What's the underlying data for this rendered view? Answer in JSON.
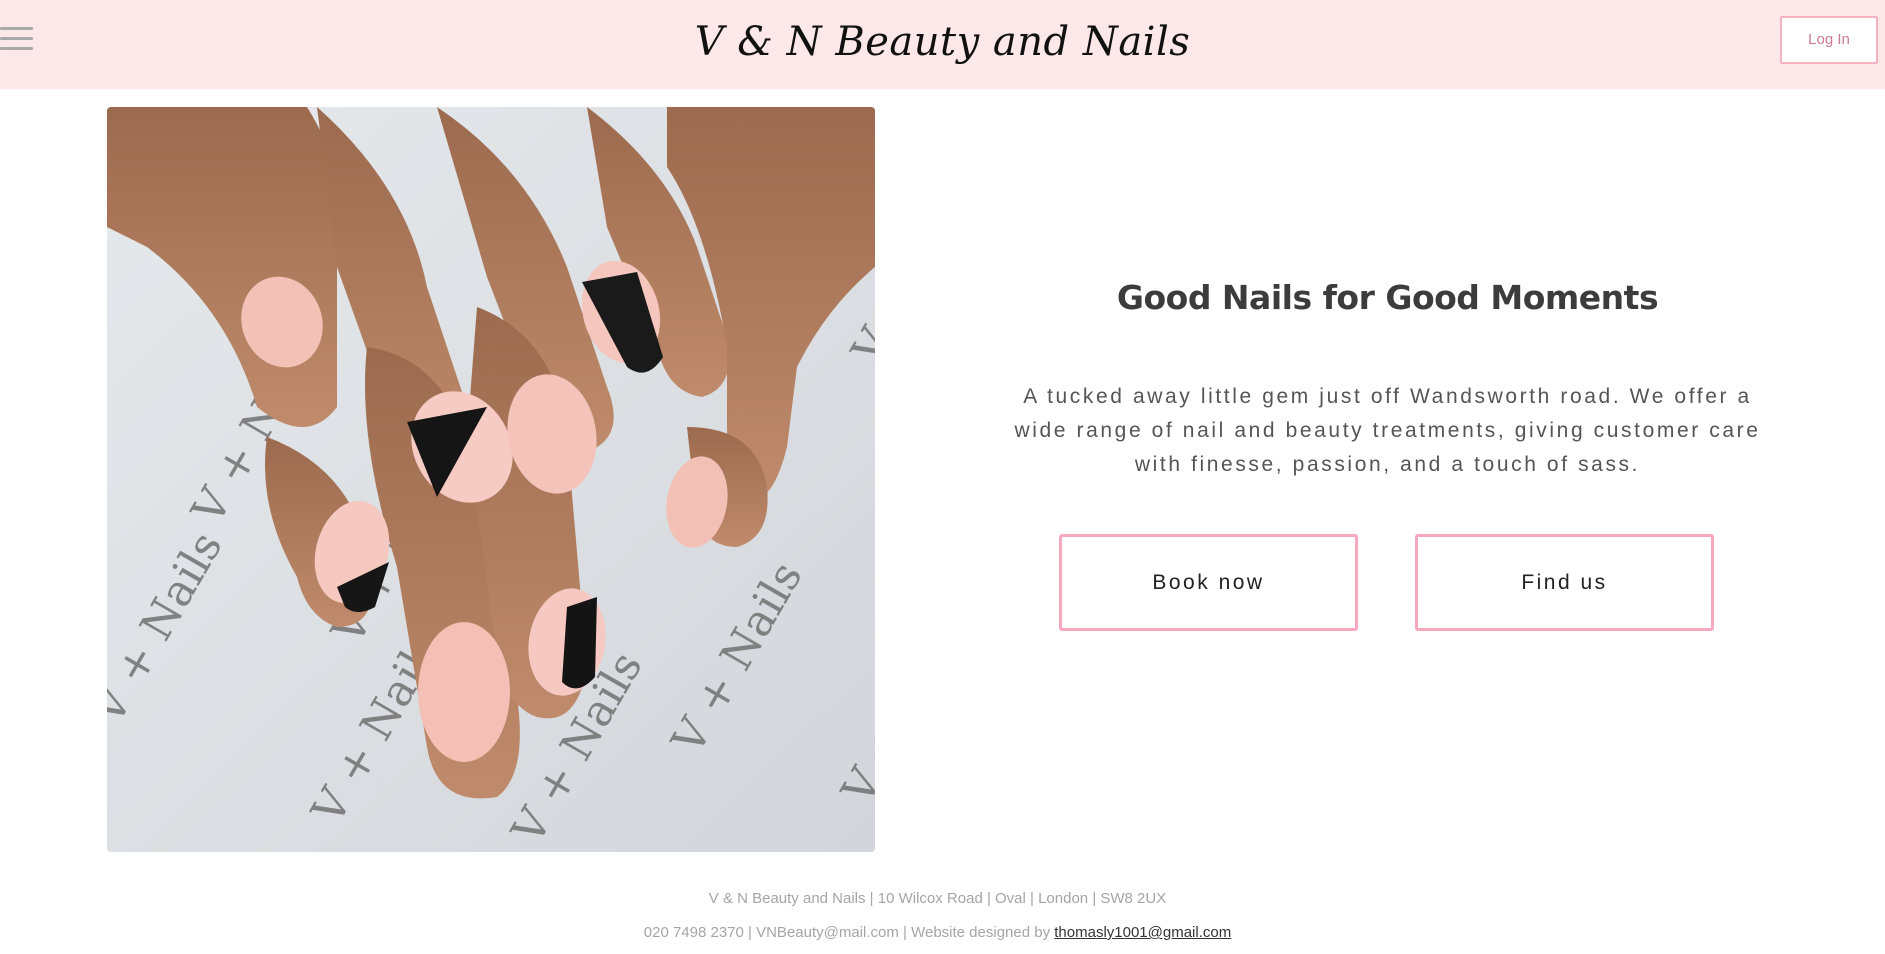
{
  "header": {
    "title": "V & N Beauty and Nails",
    "login_label": "Log In",
    "menu_icon": "hamburger-menu-icon",
    "background_color": "#fde8e9",
    "accent_color": "#f3b3c1"
  },
  "hero": {
    "image": "manicured-nails-photo",
    "photo_watermark": "V + Nails",
    "headline": "Good Nails for Good Moments",
    "description": "A tucked away little gem just off Wandsworth road. We offer a wide range of nail and beauty treatments, giving customer care with finesse, passion, and a touch of sass.",
    "buttons": {
      "book_label": "Book now",
      "find_label": "Find us"
    },
    "button_border_color": "#f7a8bd"
  },
  "footer": {
    "address": "V & N Beauty and Nails | 10 Wilcox Road | Oval | London | SW8 2UX",
    "contact": "020 7498 2370 | VNBeauty@mail.com | Website designed by ",
    "designer_email": "thomasly1001@gmail.com"
  }
}
